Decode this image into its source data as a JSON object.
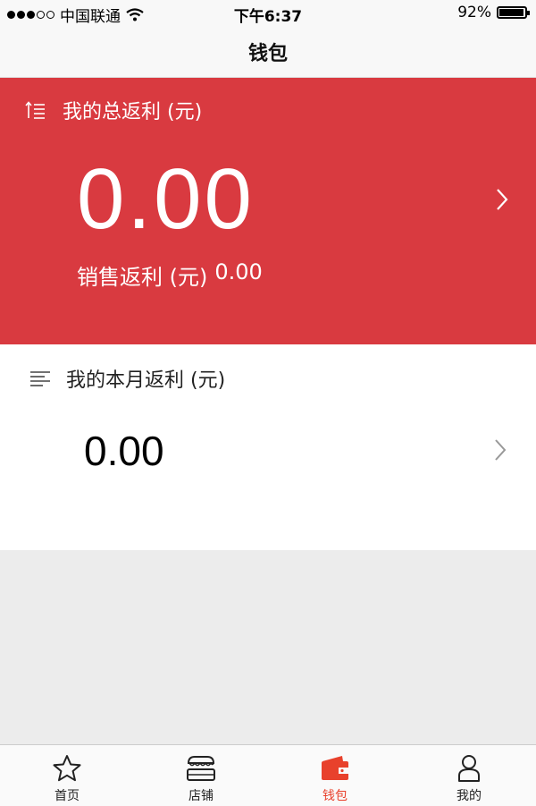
{
  "status_bar": {
    "carrier": "中国联通",
    "time": "下午6:37",
    "battery": "92%",
    "battery_level": 0.92
  },
  "nav": {
    "title": "钱包"
  },
  "total": {
    "label": "我的总返利 (元)",
    "amount": "0.00",
    "sales_label": "销售返利 (元)",
    "sales_value": "0.00"
  },
  "monthly": {
    "label": "我的本月返利 (元)",
    "amount": "0.00"
  },
  "tabs": [
    {
      "label": "首页",
      "icon": "star-icon"
    },
    {
      "label": "店铺",
      "icon": "shop-icon"
    },
    {
      "label": "钱包",
      "icon": "wallet-icon",
      "active": true
    },
    {
      "label": "我的",
      "icon": "person-icon"
    }
  ],
  "colors": {
    "accent": "#d93a40",
    "tab_active": "#e8412c"
  }
}
